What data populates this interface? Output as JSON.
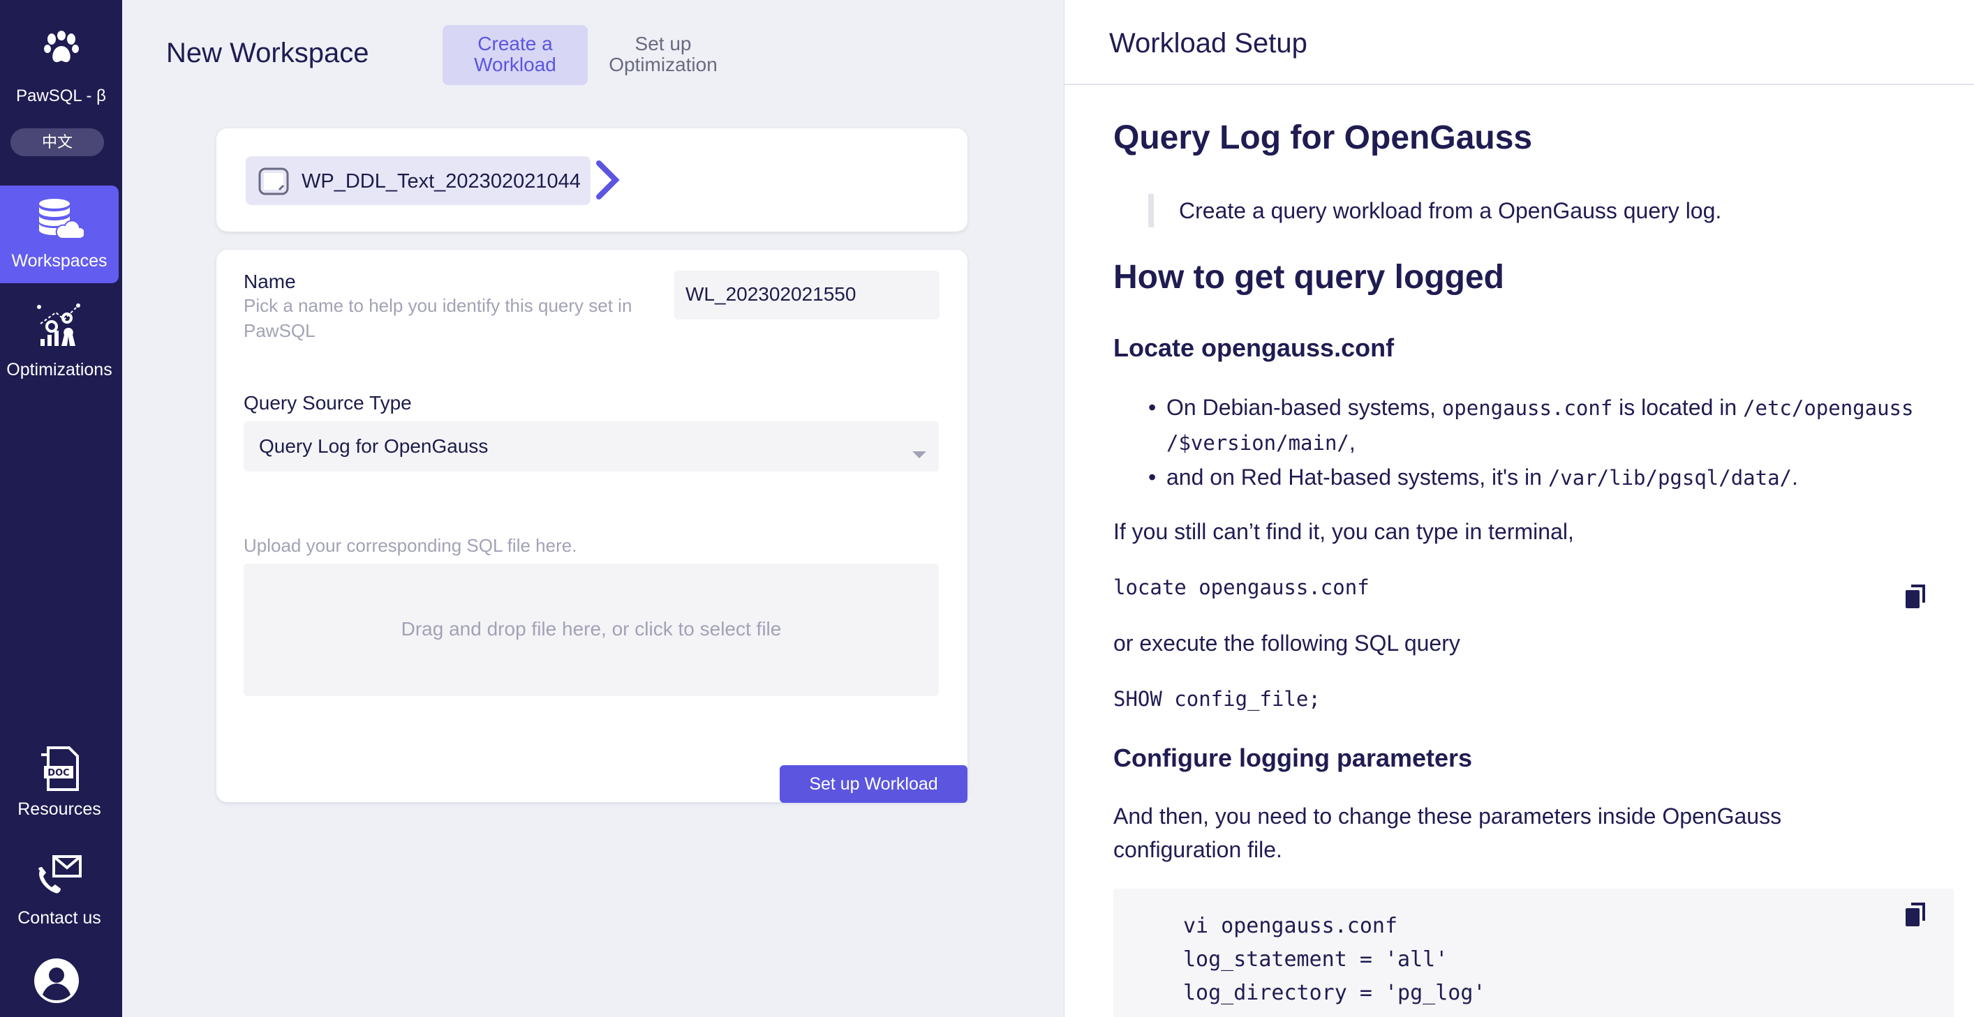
{
  "sidebar": {
    "app_name": "PawSQL - β",
    "language_button": "中文",
    "items": [
      {
        "label": "Workspaces",
        "icon": "database-cloud-icon",
        "active": true
      },
      {
        "label": "Optimizations",
        "icon": "optimization-chart-icon",
        "active": false
      },
      {
        "label": "Resources",
        "icon": "doc-icon",
        "active": false
      },
      {
        "label": "Contact us",
        "icon": "contact-phone-mail-icon",
        "active": false
      }
    ],
    "avatar_icon": "user-avatar-icon"
  },
  "main": {
    "title": "New Workspace",
    "steps": [
      {
        "label_line1": "Create a",
        "label_line2": "Workload",
        "active": true
      },
      {
        "label_line1": "Set up",
        "label_line2": "Optimization",
        "active": false
      }
    ],
    "workspace_chip": "WP_DDL_Text_202302021044",
    "name_label": "Name",
    "name_hint_line1": "Pick a name to help you identify this query set in",
    "name_hint_line2": "PawSQL",
    "name_value": "WL_202302021550",
    "source_label": "Query Source Type",
    "source_value": "Query Log for OpenGauss",
    "upload_hint": "Upload your corresponding SQL file here.",
    "dropzone_text": "Drag and drop file here, or click to select file",
    "submit_button": "Set up Workload"
  },
  "doc": {
    "header": "Workload Setup",
    "h1": "Query Log for OpenGauss",
    "quote": "Create a query workload from a OpenGauss query log.",
    "h1_2": "How to get query logged",
    "h3_locate": "Locate opengauss.conf",
    "bullet1_a": "On Debian-based systems, ",
    "bullet1_code1": "opengauss.conf",
    "bullet1_b": " is located in ",
    "bullet1_code2": "/etc/opengauss",
    "bullet1_code3": "/$version/main/",
    "bullet1_c": ",",
    "bullet2_a": "and on Red Hat-based systems, it's in ",
    "bullet2_code": "/var/lib/pgsql/data/",
    "bullet2_b": ".",
    "para_terminal": "If you still can’t find it, you can type in terminal,",
    "cmd_locate": "locate opengauss.conf",
    "para_sql": "or execute the following SQL query",
    "cmd_show": "SHOW config_file;",
    "h3_config": "Configure logging parameters",
    "para_change_1": "And then, you need to change these parameters inside OpenGauss",
    "para_change_2": "configuration file.",
    "code_lines": [
      "vi opengauss.conf",
      "log_statement = 'all'",
      "log_directory = 'pg_log'"
    ]
  },
  "colors": {
    "sidebar_bg": "#1f1c52",
    "accent": "#5b55e0",
    "page_bg": "#eef0f5"
  }
}
